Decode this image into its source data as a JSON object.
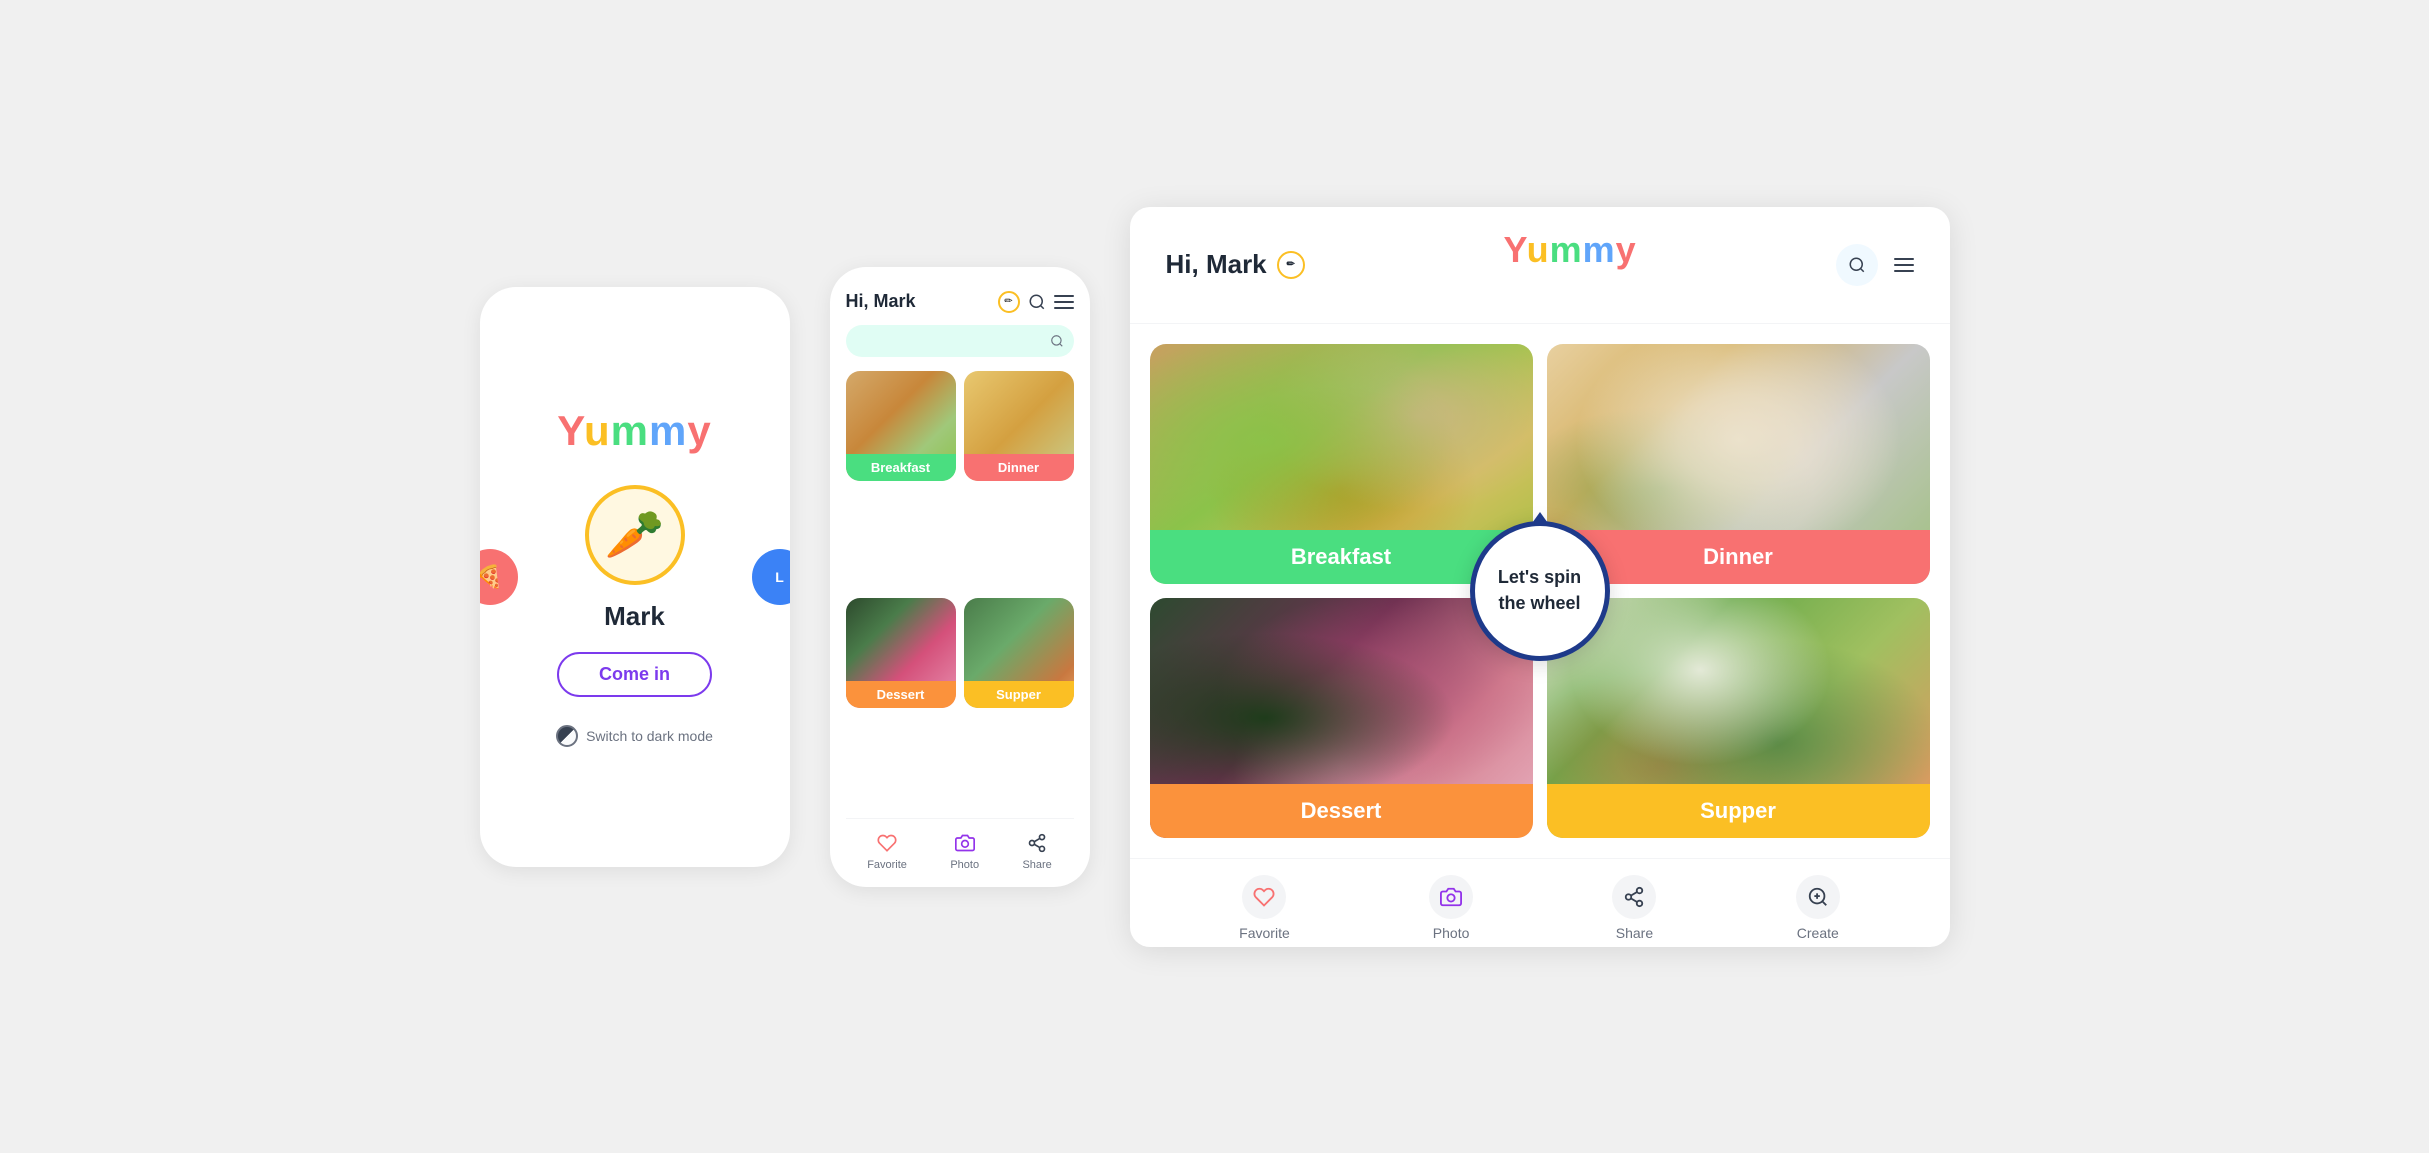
{
  "login_screen": {
    "logo": {
      "y1": "Y",
      "u": "u",
      "m1": "m",
      "m2": "m",
      "y2": "y"
    },
    "logo_text": "Yummy",
    "user_name": "Mark",
    "come_in_label": "Come in",
    "dark_mode_label": "Switch to dark mode",
    "side_left_emoji": "🍕",
    "side_right_emoji": "L",
    "carrot_emoji": "🥕"
  },
  "mobile_app": {
    "header_title": "Hi, Mark",
    "edit_icon_label": "edit",
    "search_placeholder": "",
    "food_categories": [
      {
        "label": "Breakfast",
        "color_class": "label-green"
      },
      {
        "label": "Dinner",
        "color_class": "label-red"
      },
      {
        "label": "Dessert",
        "color_class": "label-orange"
      },
      {
        "label": "Supper",
        "color_class": "label-yellow"
      }
    ],
    "bottom_nav": [
      {
        "label": "Favorite",
        "icon": "❤️"
      },
      {
        "label": "Photo",
        "icon": "📷"
      },
      {
        "label": "Share",
        "icon": "↗"
      }
    ]
  },
  "desktop_app": {
    "header": {
      "greeting": "Hi, Mark",
      "logo_y1": "Y",
      "logo_u": "u",
      "logo_m1": "m",
      "logo_m2": "m",
      "logo_y2": "y",
      "logo_text": "Yummy",
      "search_aria": "search",
      "menu_aria": "menu"
    },
    "food_categories": [
      {
        "label": "Breakfast",
        "color": "#4ade80"
      },
      {
        "label": "Dinner",
        "color": "#f87171"
      },
      {
        "label": "Dessert",
        "color": "#fb923c"
      },
      {
        "label": "Supper",
        "color": "#fbbf24"
      }
    ],
    "spin_wheel": {
      "line1": "Let's spin",
      "line2": "the wheel"
    },
    "bottom_nav": [
      {
        "label": "Favorite",
        "icon": "❤️"
      },
      {
        "label": "Photo",
        "icon": "📷"
      },
      {
        "label": "Share",
        "icon": "↗"
      },
      {
        "label": "Create",
        "icon": "🔍"
      }
    ]
  }
}
